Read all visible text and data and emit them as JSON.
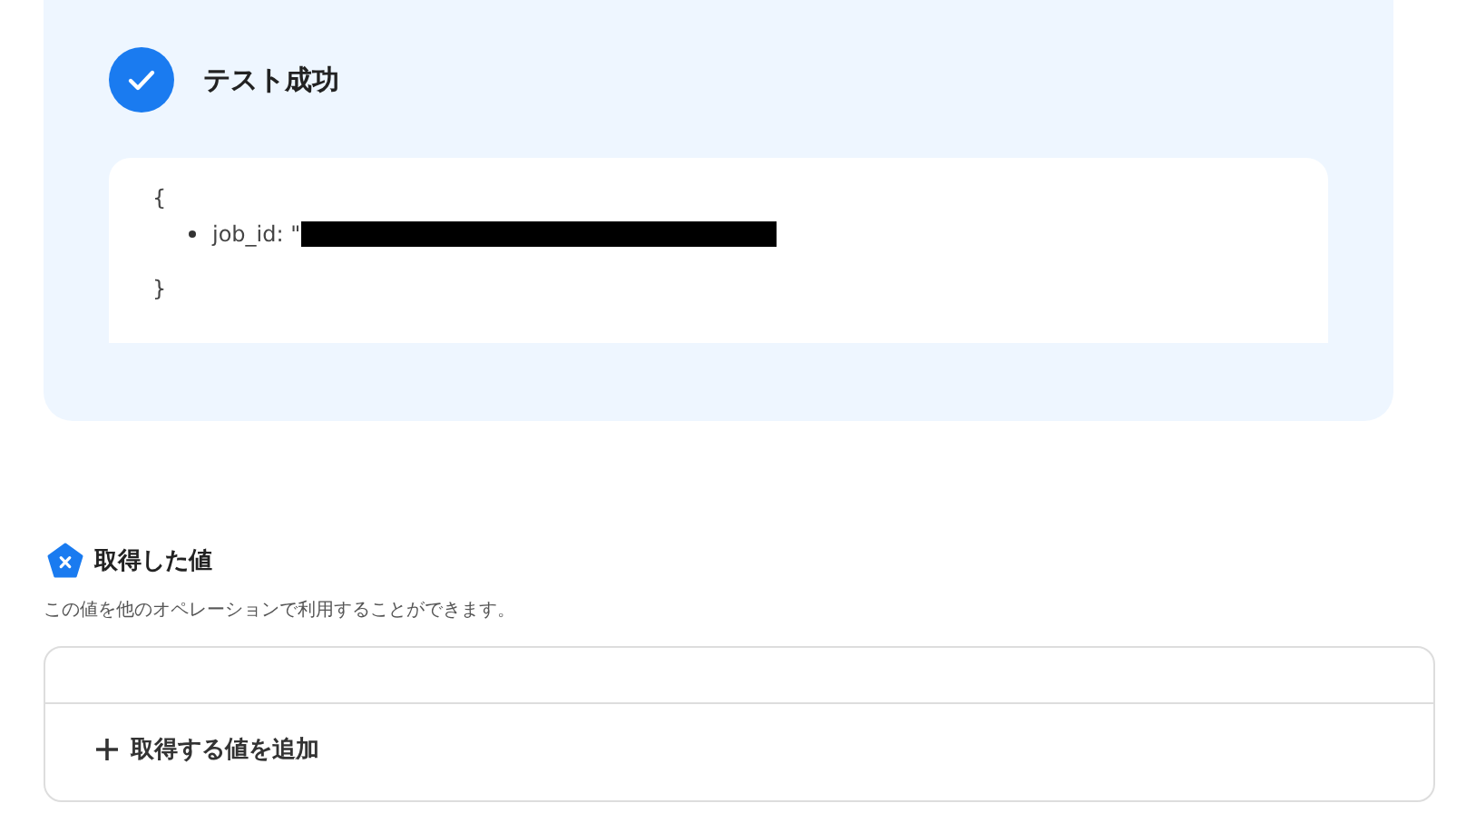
{
  "result": {
    "title": "テスト成功",
    "success": true,
    "open_brace": "{",
    "fields": [
      {
        "key": "job_id: \"",
        "redacted": true
      }
    ],
    "close_brace": "}"
  },
  "values_section": {
    "title": "取得した値",
    "description": "この値を他のオペレーションで利用することができます。",
    "add_button": "取得する値を追加"
  }
}
